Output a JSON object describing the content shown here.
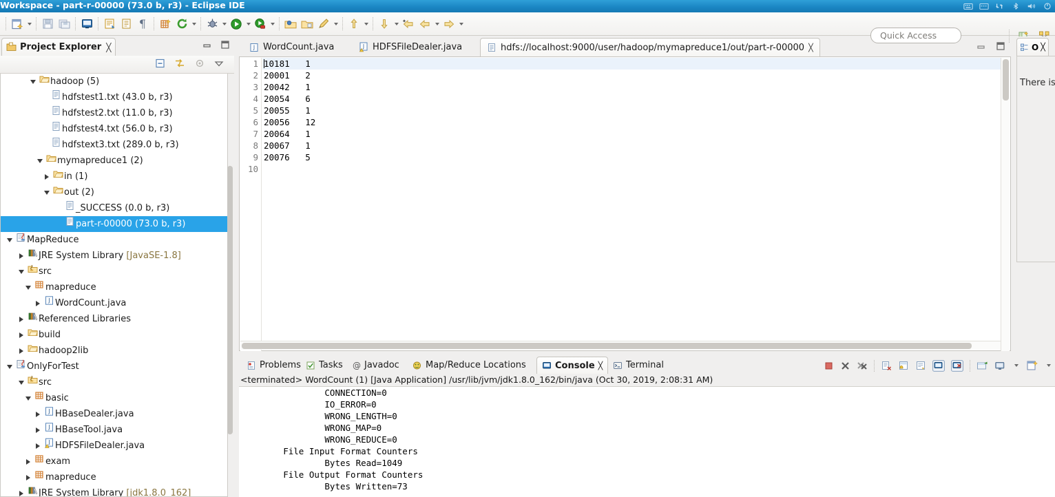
{
  "window": {
    "title": "Workspace - part-r-00000 (73.0 b, r3) - Eclipse IDE",
    "tray_icons": [
      "keyboard-icon",
      "calendar-icon",
      "network-icon",
      "bluetooth-icon",
      "volume-icon",
      "power-icon"
    ]
  },
  "toolbar": {
    "quick_access_placeholder": "Quick Access",
    "groups": [
      {
        "items": [
          {
            "name": "new-wizard-button",
            "icon": "new-file-icon",
            "dropdown": true
          },
          {
            "name": "save-button",
            "icon": "save-icon",
            "dropdown": false
          },
          {
            "name": "save-all-button",
            "icon": "save-all-icon",
            "dropdown": false
          }
        ]
      },
      {
        "items": [
          {
            "name": "toggle-console-button",
            "icon": "console-icon",
            "dropdown": false
          }
        ]
      },
      {
        "items": [
          {
            "name": "new-java-class-button",
            "icon": "java-class-icon",
            "dropdown": false
          },
          {
            "name": "open-type-button",
            "icon": "document-icon",
            "dropdown": false
          },
          {
            "name": "toggle-markoccurrences-button",
            "icon": "pilcrow-icon",
            "dropdown": false
          }
        ]
      },
      {
        "items": [
          {
            "name": "new-package-button",
            "icon": "package-icon",
            "dropdown": false
          },
          {
            "name": "refresh-button",
            "icon": "refresh-green-icon",
            "dropdown": true
          }
        ]
      },
      {
        "items": [
          {
            "name": "debug-button",
            "icon": "debug-bug-icon",
            "dropdown": true
          },
          {
            "name": "run-button",
            "icon": "run-green-play-icon",
            "dropdown": true
          },
          {
            "name": "coverage-button",
            "icon": "coverage-icon",
            "dropdown": true
          }
        ]
      },
      {
        "items": [
          {
            "name": "open-task-button",
            "icon": "open-folder-blue-icon",
            "dropdown": false
          },
          {
            "name": "open-resource-button",
            "icon": "open-folder-icon",
            "dropdown": false
          },
          {
            "name": "search-button",
            "icon": "pencil-search-icon",
            "dropdown": true
          }
        ]
      },
      {
        "items": [
          {
            "name": "previous-annotation-button",
            "icon": "up-arrow-yellow-icon",
            "dropdown": true
          },
          {
            "name": "next-annotation-button",
            "icon": "down-arrow-yellow-icon",
            "dropdown": true
          }
        ]
      },
      {
        "items": [
          {
            "name": "back-history-button",
            "icon": "back-arrow-icon",
            "dropdown": false
          },
          {
            "name": "backward-button",
            "icon": "left-arrow-icon",
            "dropdown": true
          },
          {
            "name": "forward-button",
            "icon": "right-arrow-icon",
            "dropdown": true
          }
        ]
      }
    ],
    "perspective_buttons": [
      {
        "name": "open-perspective-button",
        "icon": "open-perspective-icon"
      },
      {
        "name": "map-reduce-perspective-button",
        "icon": "map-reduce-perspective-icon"
      }
    ]
  },
  "project_explorer": {
    "tab_label": "Project Explorer",
    "tab_icon": "project-explorer-icon",
    "close_icon": "close-icon",
    "view_buttons": [
      "minimize-icon",
      "maximize-icon"
    ],
    "toolbar_icons": [
      "collapse-all-icon",
      "link-with-editor-icon",
      "focus-on-active-task-icon",
      "view-menu-icon"
    ],
    "tree": [
      {
        "indent": 2,
        "twisty": "open",
        "icon": "folder-icon",
        "label": "hadoop (5)",
        "selected": false
      },
      {
        "indent": 3,
        "twisty": "none",
        "icon": "file-icon",
        "label": "hdfstest1.txt (43.0 b, r3)",
        "selected": false
      },
      {
        "indent": 3,
        "twisty": "none",
        "icon": "file-icon",
        "label": "hdfstest2.txt (11.0 b, r3)",
        "selected": false
      },
      {
        "indent": 3,
        "twisty": "none",
        "icon": "file-icon",
        "label": "hdfstest4.txt (56.0 b, r3)",
        "selected": false
      },
      {
        "indent": 3,
        "twisty": "none",
        "icon": "file-icon",
        "label": "hdfstext3.txt (289.0 b, r3)",
        "selected": false
      },
      {
        "indent": 2.6,
        "twisty": "open",
        "icon": "folder-icon",
        "label": "mymapreduce1 (2)",
        "selected": false
      },
      {
        "indent": 3.2,
        "twisty": "closed",
        "icon": "folder-icon",
        "label": "in (1)",
        "selected": false
      },
      {
        "indent": 3.2,
        "twisty": "open",
        "icon": "folder-icon",
        "label": "out (2)",
        "selected": false
      },
      {
        "indent": 4.2,
        "twisty": "none",
        "icon": "file-icon",
        "label": "_SUCCESS (0.0 b, r3)",
        "selected": false
      },
      {
        "indent": 4.2,
        "twisty": "none",
        "icon": "file-icon",
        "label": "part-r-00000 (73.0 b, r3)",
        "selected": true
      },
      {
        "indent": 0,
        "twisty": "open",
        "icon": "java-project-icon",
        "label": "MapReduce",
        "selected": false
      },
      {
        "indent": 1,
        "twisty": "closed",
        "icon": "library-icon",
        "label": "JRE System Library ",
        "suffix": "[JavaSE-1.8]",
        "selected": false
      },
      {
        "indent": 1,
        "twisty": "open",
        "icon": "source-folder-icon",
        "label": "src",
        "selected": false
      },
      {
        "indent": 1.6,
        "twisty": "open",
        "icon": "package-icon",
        "label": "mapreduce",
        "selected": false
      },
      {
        "indent": 2.4,
        "twisty": "closed",
        "icon": "java-file-icon",
        "label": "WordCount.java",
        "selected": false
      },
      {
        "indent": 1,
        "twisty": "closed",
        "icon": "library-icon",
        "label": "Referenced Libraries",
        "selected": false
      },
      {
        "indent": 1,
        "twisty": "closed",
        "icon": "folder-icon",
        "label": "build",
        "selected": false
      },
      {
        "indent": 1,
        "twisty": "closed",
        "icon": "folder-icon",
        "label": "hadoop2lib",
        "selected": false
      },
      {
        "indent": 0,
        "twisty": "open",
        "icon": "java-project-icon",
        "label": "OnlyForTest",
        "selected": false
      },
      {
        "indent": 1,
        "twisty": "open",
        "icon": "source-folder-icon",
        "label": "src",
        "selected": false
      },
      {
        "indent": 1.6,
        "twisty": "open",
        "icon": "package-icon",
        "label": "basic",
        "selected": false
      },
      {
        "indent": 2.4,
        "twisty": "closed",
        "icon": "java-file-icon",
        "label": "HBaseDealer.java",
        "selected": false
      },
      {
        "indent": 2.4,
        "twisty": "closed",
        "icon": "java-file-icon",
        "label": "HBaseTool.java",
        "selected": false
      },
      {
        "indent": 2.4,
        "twisty": "closed",
        "icon": "java-file-warn-icon",
        "label": "HDFSFileDealer.java",
        "selected": false
      },
      {
        "indent": 1.6,
        "twisty": "closed",
        "icon": "package-icon",
        "label": "exam",
        "selected": false
      },
      {
        "indent": 1.6,
        "twisty": "closed",
        "icon": "package-icon",
        "label": "mapreduce",
        "selected": false
      },
      {
        "indent": 1,
        "twisty": "closed",
        "icon": "library-icon",
        "label": "JRE System Library ",
        "suffix": "[jdk1.8.0_162]",
        "selected": false
      }
    ]
  },
  "editor": {
    "tabs": [
      {
        "label": "WordCount.java",
        "icon": "java-file-icon",
        "active": false,
        "closeable": false
      },
      {
        "label": "HDFSFileDealer.java",
        "icon": "java-file-warn-icon",
        "active": false,
        "closeable": false
      },
      {
        "label": "hdfs://localhost:9000/user/hadoop/mymapreduce1/out/part-r-00000",
        "icon": "text-file-icon",
        "active": true,
        "closeable": true
      }
    ],
    "close_icon": "close-icon",
    "view_buttons": [
      "minimize-icon",
      "maximize-icon"
    ],
    "line_numbers": [
      "1",
      "2",
      "3",
      "4",
      "5",
      "6",
      "7",
      "8",
      "9",
      "10"
    ],
    "lines": [
      "10181   1",
      "20001   2",
      "20042   1",
      "20054   6",
      "20055   1",
      "20056   12",
      "20064   1",
      "20067   1",
      "20076   5",
      ""
    ],
    "cursor_line": 1
  },
  "outline": {
    "tab_label": "O",
    "tab_icon": "outline-icon",
    "close_icon": "close-icon",
    "message": "There is no active editor that provides an outline."
  },
  "console": {
    "tabs": [
      {
        "label": "Problems",
        "icon": "problems-icon",
        "active": false
      },
      {
        "label": "Tasks",
        "icon": "tasks-icon",
        "active": false
      },
      {
        "label": "Javadoc",
        "icon": "javadoc-icon",
        "active": false
      },
      {
        "label": "Map/Reduce Locations",
        "icon": "map-reduce-locations-icon",
        "active": false
      },
      {
        "label": "Console",
        "icon": "console-icon",
        "active": true
      },
      {
        "label": "Terminal",
        "icon": "terminal-icon",
        "active": false
      }
    ],
    "close_icon": "close-icon",
    "header": "<terminated> WordCount (1) [Java Application] /usr/lib/jvm/jdk1.8.0_162/bin/java (Oct 30, 2019, 2:08:31 AM)",
    "toolbar_icons": [
      "terminate-icon",
      "remove-launch-icon",
      "remove-all-launches-icon",
      "clear-console-icon",
      "scroll-lock-icon",
      "word-wrap-icon",
      "show-console-on-output-icon",
      "show-console-on-error-icon",
      "pin-console-icon",
      "display-selected-console-icon",
      "open-console-icon"
    ],
    "lines": [
      "                CONNECTION=0",
      "                IO_ERROR=0",
      "                WRONG_LENGTH=0",
      "                WRONG_MAP=0",
      "                WRONG_REDUCE=0",
      "        File Input Format Counters",
      "                Bytes Read=1049",
      "        File Output Format Counters",
      "                Bytes Written=73"
    ]
  },
  "colors": {
    "titlebar": "#1b87c4",
    "selection": "#29a3e8",
    "current_line": "#eaf2fb",
    "panel_bg": "#f0efee"
  }
}
